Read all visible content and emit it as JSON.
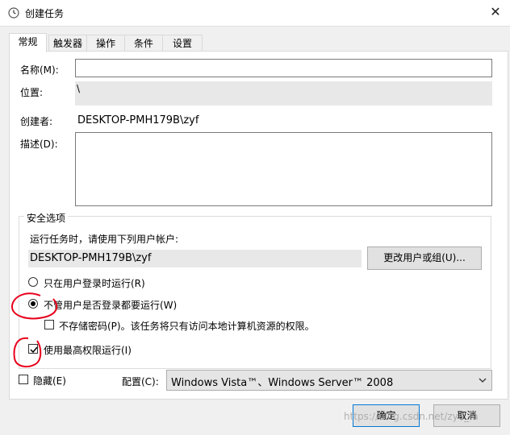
{
  "window": {
    "title": "创建任务",
    "close_glyph": "✕"
  },
  "tabs": [
    {
      "label": "常规",
      "active": true
    },
    {
      "label": "触发器"
    },
    {
      "label": "操作"
    },
    {
      "label": "条件"
    },
    {
      "label": "设置"
    }
  ],
  "general": {
    "name_label": "名称(M):",
    "name_value": "",
    "location_label": "位置:",
    "location_value": "\\",
    "author_label": "创建者:",
    "author_value": "DESKTOP-PMH179B\\zyf",
    "description_label": "描述(D):",
    "description_value": ""
  },
  "security": {
    "legend": "安全选项",
    "run_as_label": "运行任务时，请使用下列用户帐户:",
    "run_as_value": "DESKTOP-PMH179B\\zyf",
    "change_user_button": "更改用户或组(U)...",
    "radio_logged_on": "只在用户登录时运行(R)",
    "radio_logged_on_selected": false,
    "radio_whether_logged": "不管用户是否登录都要运行(W)",
    "radio_whether_logged_selected": true,
    "no_store_password": "不存储密码(P)。该任务将只有访问本地计算机资源的权限。",
    "no_store_password_checked": false,
    "highest_privileges": "使用最高权限运行(I)",
    "highest_privileges_checked": true
  },
  "footer": {
    "hidden_label": "隐藏(E)",
    "hidden_checked": false,
    "config_label": "配置(C):",
    "config_value": "Windows Vista™、Windows Server™ 2008",
    "ok_button": "确定",
    "cancel_button": "取消",
    "watermark": "https://blog.csdn.net/zye_fa"
  },
  "colors": {
    "accent": "#0078d7",
    "annotation": "#e8001c"
  }
}
